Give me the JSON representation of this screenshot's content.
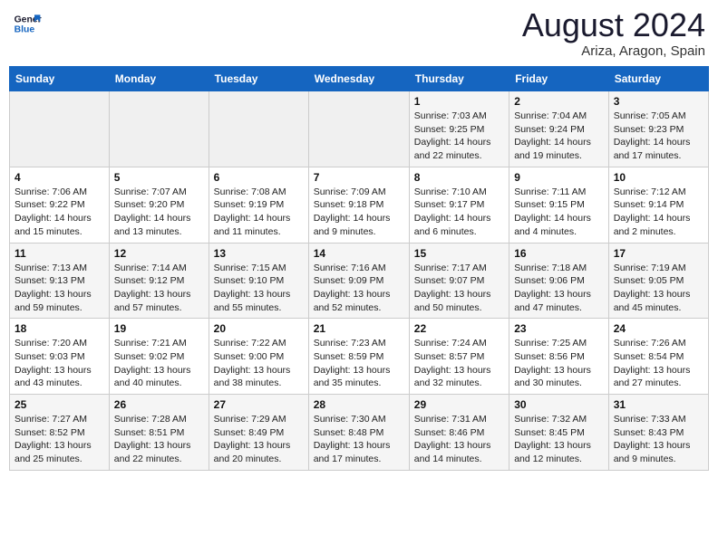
{
  "logo": {
    "line1": "General",
    "line2": "Blue"
  },
  "title": "August 2024",
  "location": "Ariza, Aragon, Spain",
  "days_of_week": [
    "Sunday",
    "Monday",
    "Tuesday",
    "Wednesday",
    "Thursday",
    "Friday",
    "Saturday"
  ],
  "weeks": [
    [
      {
        "num": "",
        "info": ""
      },
      {
        "num": "",
        "info": ""
      },
      {
        "num": "",
        "info": ""
      },
      {
        "num": "",
        "info": ""
      },
      {
        "num": "1",
        "info": "Sunrise: 7:03 AM\nSunset: 9:25 PM\nDaylight: 14 hours\nand 22 minutes."
      },
      {
        "num": "2",
        "info": "Sunrise: 7:04 AM\nSunset: 9:24 PM\nDaylight: 14 hours\nand 19 minutes."
      },
      {
        "num": "3",
        "info": "Sunrise: 7:05 AM\nSunset: 9:23 PM\nDaylight: 14 hours\nand 17 minutes."
      }
    ],
    [
      {
        "num": "4",
        "info": "Sunrise: 7:06 AM\nSunset: 9:22 PM\nDaylight: 14 hours\nand 15 minutes."
      },
      {
        "num": "5",
        "info": "Sunrise: 7:07 AM\nSunset: 9:20 PM\nDaylight: 14 hours\nand 13 minutes."
      },
      {
        "num": "6",
        "info": "Sunrise: 7:08 AM\nSunset: 9:19 PM\nDaylight: 14 hours\nand 11 minutes."
      },
      {
        "num": "7",
        "info": "Sunrise: 7:09 AM\nSunset: 9:18 PM\nDaylight: 14 hours\nand 9 minutes."
      },
      {
        "num": "8",
        "info": "Sunrise: 7:10 AM\nSunset: 9:17 PM\nDaylight: 14 hours\nand 6 minutes."
      },
      {
        "num": "9",
        "info": "Sunrise: 7:11 AM\nSunset: 9:15 PM\nDaylight: 14 hours\nand 4 minutes."
      },
      {
        "num": "10",
        "info": "Sunrise: 7:12 AM\nSunset: 9:14 PM\nDaylight: 14 hours\nand 2 minutes."
      }
    ],
    [
      {
        "num": "11",
        "info": "Sunrise: 7:13 AM\nSunset: 9:13 PM\nDaylight: 13 hours\nand 59 minutes."
      },
      {
        "num": "12",
        "info": "Sunrise: 7:14 AM\nSunset: 9:12 PM\nDaylight: 13 hours\nand 57 minutes."
      },
      {
        "num": "13",
        "info": "Sunrise: 7:15 AM\nSunset: 9:10 PM\nDaylight: 13 hours\nand 55 minutes."
      },
      {
        "num": "14",
        "info": "Sunrise: 7:16 AM\nSunset: 9:09 PM\nDaylight: 13 hours\nand 52 minutes."
      },
      {
        "num": "15",
        "info": "Sunrise: 7:17 AM\nSunset: 9:07 PM\nDaylight: 13 hours\nand 50 minutes."
      },
      {
        "num": "16",
        "info": "Sunrise: 7:18 AM\nSunset: 9:06 PM\nDaylight: 13 hours\nand 47 minutes."
      },
      {
        "num": "17",
        "info": "Sunrise: 7:19 AM\nSunset: 9:05 PM\nDaylight: 13 hours\nand 45 minutes."
      }
    ],
    [
      {
        "num": "18",
        "info": "Sunrise: 7:20 AM\nSunset: 9:03 PM\nDaylight: 13 hours\nand 43 minutes."
      },
      {
        "num": "19",
        "info": "Sunrise: 7:21 AM\nSunset: 9:02 PM\nDaylight: 13 hours\nand 40 minutes."
      },
      {
        "num": "20",
        "info": "Sunrise: 7:22 AM\nSunset: 9:00 PM\nDaylight: 13 hours\nand 38 minutes."
      },
      {
        "num": "21",
        "info": "Sunrise: 7:23 AM\nSunset: 8:59 PM\nDaylight: 13 hours\nand 35 minutes."
      },
      {
        "num": "22",
        "info": "Sunrise: 7:24 AM\nSunset: 8:57 PM\nDaylight: 13 hours\nand 32 minutes."
      },
      {
        "num": "23",
        "info": "Sunrise: 7:25 AM\nSunset: 8:56 PM\nDaylight: 13 hours\nand 30 minutes."
      },
      {
        "num": "24",
        "info": "Sunrise: 7:26 AM\nSunset: 8:54 PM\nDaylight: 13 hours\nand 27 minutes."
      }
    ],
    [
      {
        "num": "25",
        "info": "Sunrise: 7:27 AM\nSunset: 8:52 PM\nDaylight: 13 hours\nand 25 minutes."
      },
      {
        "num": "26",
        "info": "Sunrise: 7:28 AM\nSunset: 8:51 PM\nDaylight: 13 hours\nand 22 minutes."
      },
      {
        "num": "27",
        "info": "Sunrise: 7:29 AM\nSunset: 8:49 PM\nDaylight: 13 hours\nand 20 minutes."
      },
      {
        "num": "28",
        "info": "Sunrise: 7:30 AM\nSunset: 8:48 PM\nDaylight: 13 hours\nand 17 minutes."
      },
      {
        "num": "29",
        "info": "Sunrise: 7:31 AM\nSunset: 8:46 PM\nDaylight: 13 hours\nand 14 minutes."
      },
      {
        "num": "30",
        "info": "Sunrise: 7:32 AM\nSunset: 8:45 PM\nDaylight: 13 hours\nand 12 minutes."
      },
      {
        "num": "31",
        "info": "Sunrise: 7:33 AM\nSunset: 8:43 PM\nDaylight: 13 hours\nand 9 minutes."
      }
    ]
  ]
}
